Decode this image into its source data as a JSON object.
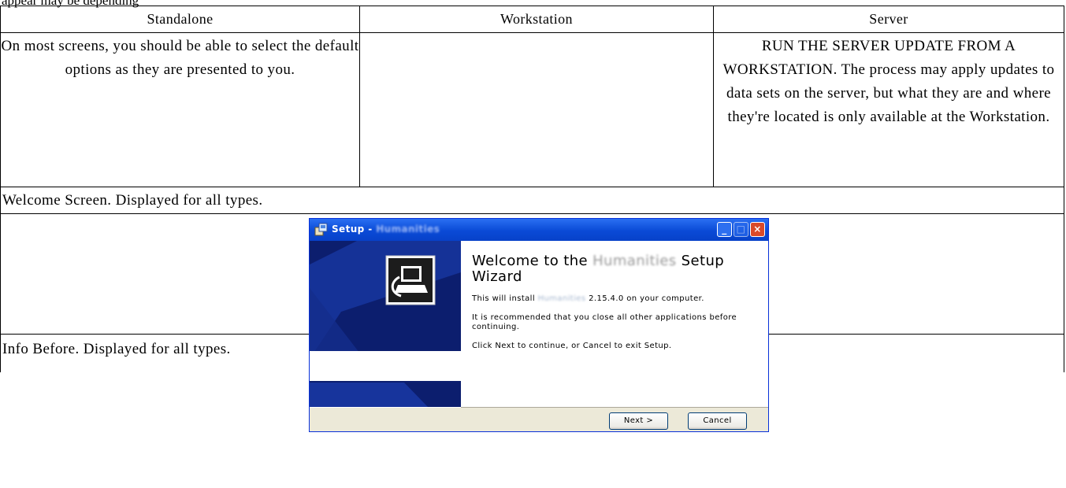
{
  "cut_top_text": "appear may be depending",
  "table": {
    "headers": [
      "Standalone",
      "Workstation",
      "Server"
    ],
    "row1": {
      "standalone": "On most screens, you should be able to select the default options as they are presented to you.",
      "workstation": "",
      "server": "RUN THE SERVER UPDATE FROM A WORKSTATION. The process may apply updates to data sets on the server, but what they are and where they're located is only available at the Workstation."
    },
    "caption1": "Welcome Screen. Displayed for all types.",
    "caption2": "Info Before. Displayed for all types."
  },
  "dialog": {
    "title_prefix": "Setup - ",
    "title_app": "Humanities",
    "window_buttons": {
      "minimize": "_",
      "maximize": "□",
      "close": "×"
    },
    "heading_part1": "Welcome to the ",
    "heading_app": "Humanities",
    "heading_part2": " Setup Wizard",
    "line1_part1": "This will install ",
    "line1_app": "Humanities",
    "line1_part2": " 2.15.4.0 on your computer.",
    "line2": "It is recommended that you close all other applications before continuing.",
    "line3": "Click Next to continue, or Cancel to exit Setup.",
    "next_label": "Next >",
    "cancel_label": "Cancel",
    "icons": {
      "title": "setup-package-icon",
      "panel": "computer-install-icon"
    }
  }
}
